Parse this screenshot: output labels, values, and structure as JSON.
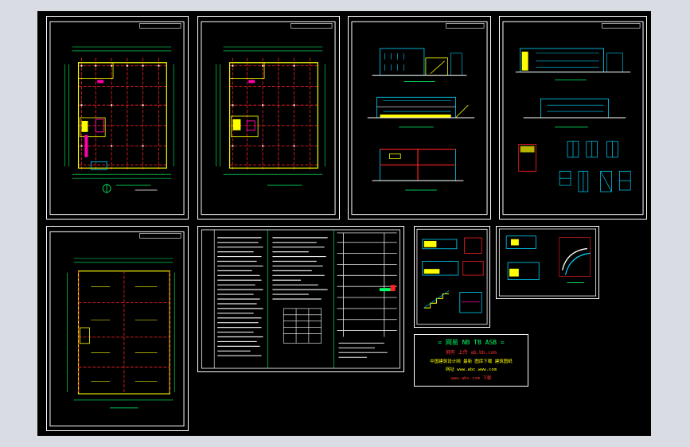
{
  "colors": {
    "background": "#d9dce3",
    "canvas": "#000000",
    "sheet_border": "#ffffff",
    "wall": "#ffff00",
    "axis": "#ff2222",
    "dimension": "#00ff66",
    "column": "#ffffff",
    "detail": "#00d5ff",
    "accent": "#ff00aa",
    "stamp_title": "#00ff66",
    "stamp_red": "#ff3030",
    "stamp_yellow": "#ffff00"
  },
  "sheets": [
    {
      "id": "first-floor-plan",
      "label": "first floor plan"
    },
    {
      "id": "second-floor-plan",
      "label": "second floor plan"
    },
    {
      "id": "elevations-sections",
      "label": "elevations and section"
    },
    {
      "id": "elevations-windows",
      "label": "elevations and window schedule"
    },
    {
      "id": "roof-plan",
      "label": "roof plan"
    },
    {
      "id": "design-notes",
      "label": "design notes"
    },
    {
      "id": "stair-details",
      "label": "stair details"
    },
    {
      "id": "stair-plans",
      "label": "stair plans"
    }
  ],
  "stamp": {
    "line1": "= 网易 NB TB ASB =",
    "line2": "拥有 上传 ab.bb.com",
    "line3": "中国建筑设计网 最新 图库下载 建筑图纸",
    "line4": "网址 www.abc.www.com",
    "line5": "www.abc.com 下载"
  }
}
